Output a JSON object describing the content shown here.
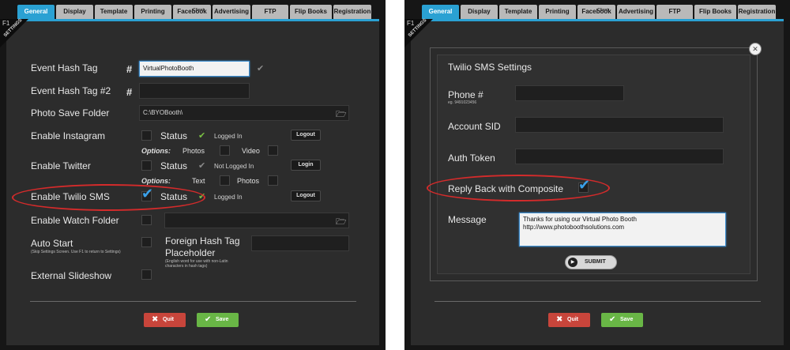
{
  "tabs": [
    {
      "label": "General"
    },
    {
      "label": "Display"
    },
    {
      "label": "Template"
    },
    {
      "label": "Printing"
    },
    {
      "label": "Facebook",
      "sup": "Client"
    },
    {
      "label": "Advertising"
    },
    {
      "label": "FTP"
    },
    {
      "label": "Flip Books"
    },
    {
      "label": "Registration"
    }
  ],
  "corner": {
    "f1": "F1",
    "settings": "SETTINGS"
  },
  "general": {
    "event_hash_tag": {
      "label": "Event Hash Tag",
      "hash": "#",
      "value": "VirtualPhotoBooth"
    },
    "event_hash_tag2": {
      "label": "Event Hash Tag #2",
      "hash": "#",
      "value": ""
    },
    "photo_save_folder": {
      "label": "Photo Save Folder",
      "value": "C:\\BYOBooth\\"
    },
    "instagram": {
      "label": "Enable Instagram",
      "status": "Status",
      "state": "Logged In",
      "button": "Logout",
      "options_label": "Options:",
      "opt1": "Photos",
      "opt2": "Video"
    },
    "twitter": {
      "label": "Enable Twitter",
      "status": "Status",
      "state": "Not Logged In",
      "button": "Login",
      "options_label": "Options:",
      "opt1": "Text",
      "opt2": "Photos"
    },
    "twilio": {
      "label": "Enable Twilio SMS",
      "status": "Status",
      "state": "Logged In",
      "button": "Logout"
    },
    "watch_folder": {
      "label": "Enable Watch Folder",
      "value": ""
    },
    "auto_start": {
      "label": "Auto Start",
      "note": "(Skip Settings Screen. Use F1 to return to Settings)"
    },
    "foreign_hash": {
      "label1": "Foreign Hash Tag",
      "label2": "Placeholder",
      "note1": "(English word for use with non-Latin",
      "note2": "characters in hash tags)",
      "value": ""
    },
    "external_slideshow": {
      "label": "External Slideshow"
    }
  },
  "buttons": {
    "quit": "Quit",
    "save": "Save"
  },
  "twilio_modal": {
    "title": "Twilio SMS Settings",
    "phone_label": "Phone #",
    "phone_example": "eg. 9491023456",
    "phone_value": "",
    "account_sid_label": "Account SID",
    "account_sid_value": "",
    "auth_token_label": "Auth Token",
    "auth_token_value": "",
    "reply_label": "Reply Back with Composite",
    "message_label": "Message",
    "message_line1": "Thanks for using our Virtual Photo Booth",
    "message_line2": "http://www.photoboothsolutions.com",
    "submit": "SUBMIT",
    "close": "✕"
  },
  "colors": {
    "accent": "#2aa1d3",
    "quit": "#c8453b",
    "save": "#69b646",
    "highlight_ellipse": "#d42b2b"
  }
}
